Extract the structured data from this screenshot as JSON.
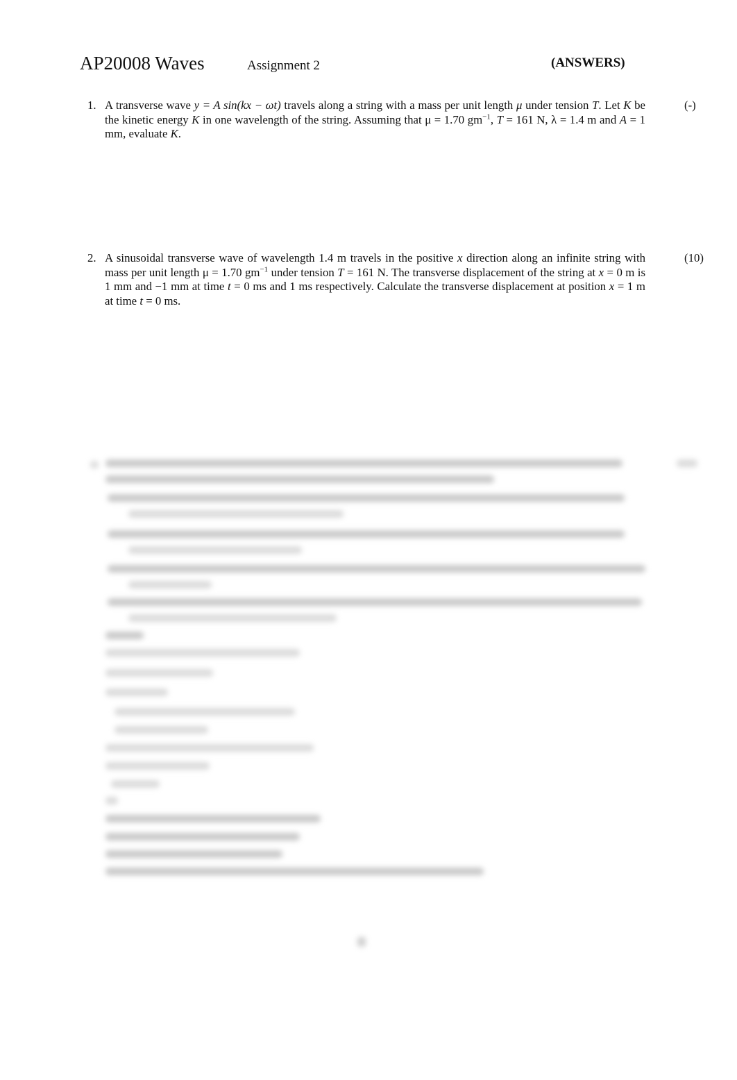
{
  "header": {
    "course": "AP20008 Waves",
    "assignment": "Assignment 2",
    "tag": "(ANSWERS)"
  },
  "questions": [
    {
      "number": "1.",
      "marks": "(-)",
      "text_parts": {
        "p1": "A transverse wave ",
        "eq1": "y = A sin(kx − ωt)",
        "p2": " travels along a string with a mass per unit length ",
        "mu": "μ",
        "p3": " under tension ",
        "T": "T",
        "p4": ". Let ",
        "K1": "K",
        "p5": " be the kinetic energy ",
        "K2": "K",
        "p6": " in one wavelength of the string. Assuming that ",
        "eq2": "μ = 1.70 gm",
        "sup1": "−1",
        "p7": ", ",
        "eq3": "T",
        "p8": " = 161 N, λ = 1.4 m and ",
        "eq4": "A",
        "p9": " = 1 mm, evaluate ",
        "K3": "K",
        "p10": "."
      }
    },
    {
      "number": "2.",
      "marks": "(10)",
      "text_parts": {
        "p1": "A sinusoidal transverse wave of wavelength 1.4 m travels in the positive ",
        "x1": "x",
        "p2": " direction along an infinite string with mass per unit length ",
        "eq1": "μ = 1.70 gm",
        "sup1": "−1",
        "p3": " under tension ",
        "T": "T",
        "p4": " = 161 N. The transverse displacement of the string at ",
        "x2": "x",
        "p5": " = 0 m is 1 mm and −1 mm at time ",
        "t1": "t",
        "p6": " = 0 ms and 1 ms respectively. Calculate the transverse displacement at position ",
        "x3": "x",
        "p7": " = 1 m at time ",
        "t2": "t",
        "p8": " = 0 ms."
      }
    }
  ],
  "blurred_section": {
    "description": "Question 3 and its answers are blurred and unreadable"
  }
}
